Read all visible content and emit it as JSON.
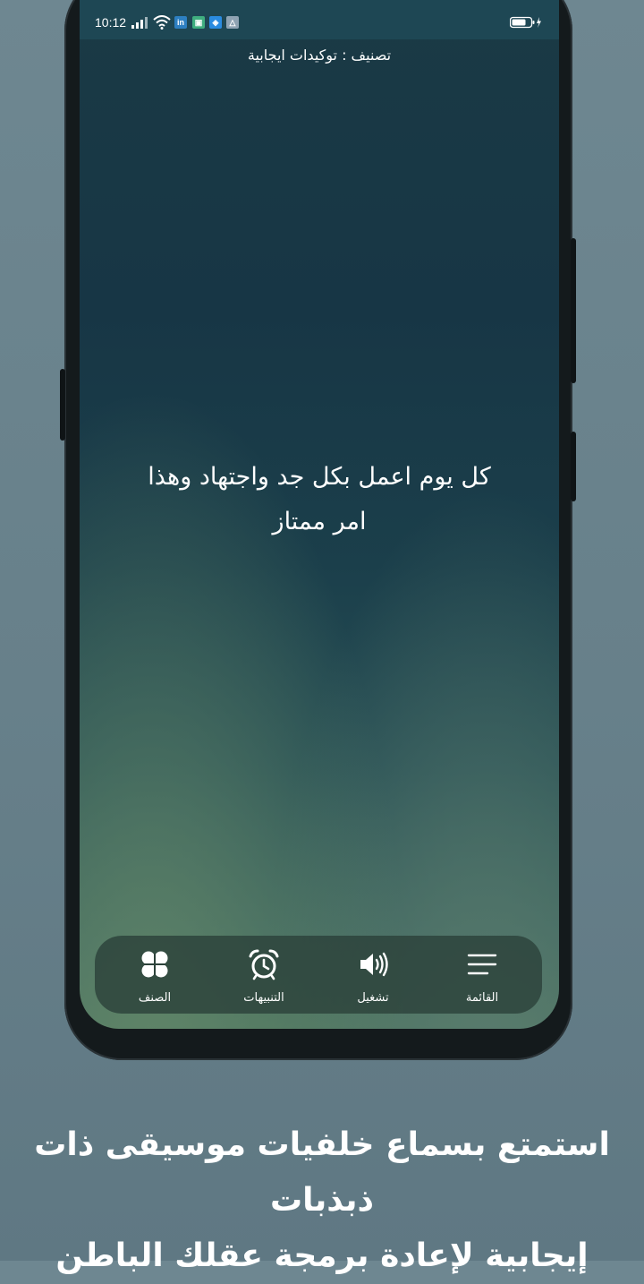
{
  "status_bar": {
    "time": "10:12",
    "icons": [
      "signal-icon",
      "wifi-icon",
      "linkedin-icon",
      "app-icon",
      "app-icon",
      "app-icon",
      "battery-charging-icon"
    ]
  },
  "header": {
    "category_label": "تصنيف : توكيدات ايجابية"
  },
  "affirmation": {
    "line1": "كل يوم اعمل بكل جد واجتهاد وهذا",
    "line2": "امر ممتاز"
  },
  "bottom_nav": {
    "items": [
      {
        "label": "الصنف",
        "icon": "clover-icon"
      },
      {
        "label": "التنبيهات",
        "icon": "alarm-clock-icon"
      },
      {
        "label": "تشغيل",
        "icon": "speaker-icon"
      },
      {
        "label": "القائمة",
        "icon": "menu-icon"
      }
    ]
  },
  "promo_caption": {
    "line1": "استمتع بسماع خلفيات موسيقى ذات ذبذبات",
    "line2": "إيجابية لإعادة برمجة عقلك الباطن"
  },
  "colors": {
    "page_background": "#67808a",
    "screen_top": "#1a3a45",
    "screen_bottom": "#4a725f",
    "status_bar": "#1e4754",
    "nav_background": "#2c423a",
    "text": "#ffffff"
  }
}
